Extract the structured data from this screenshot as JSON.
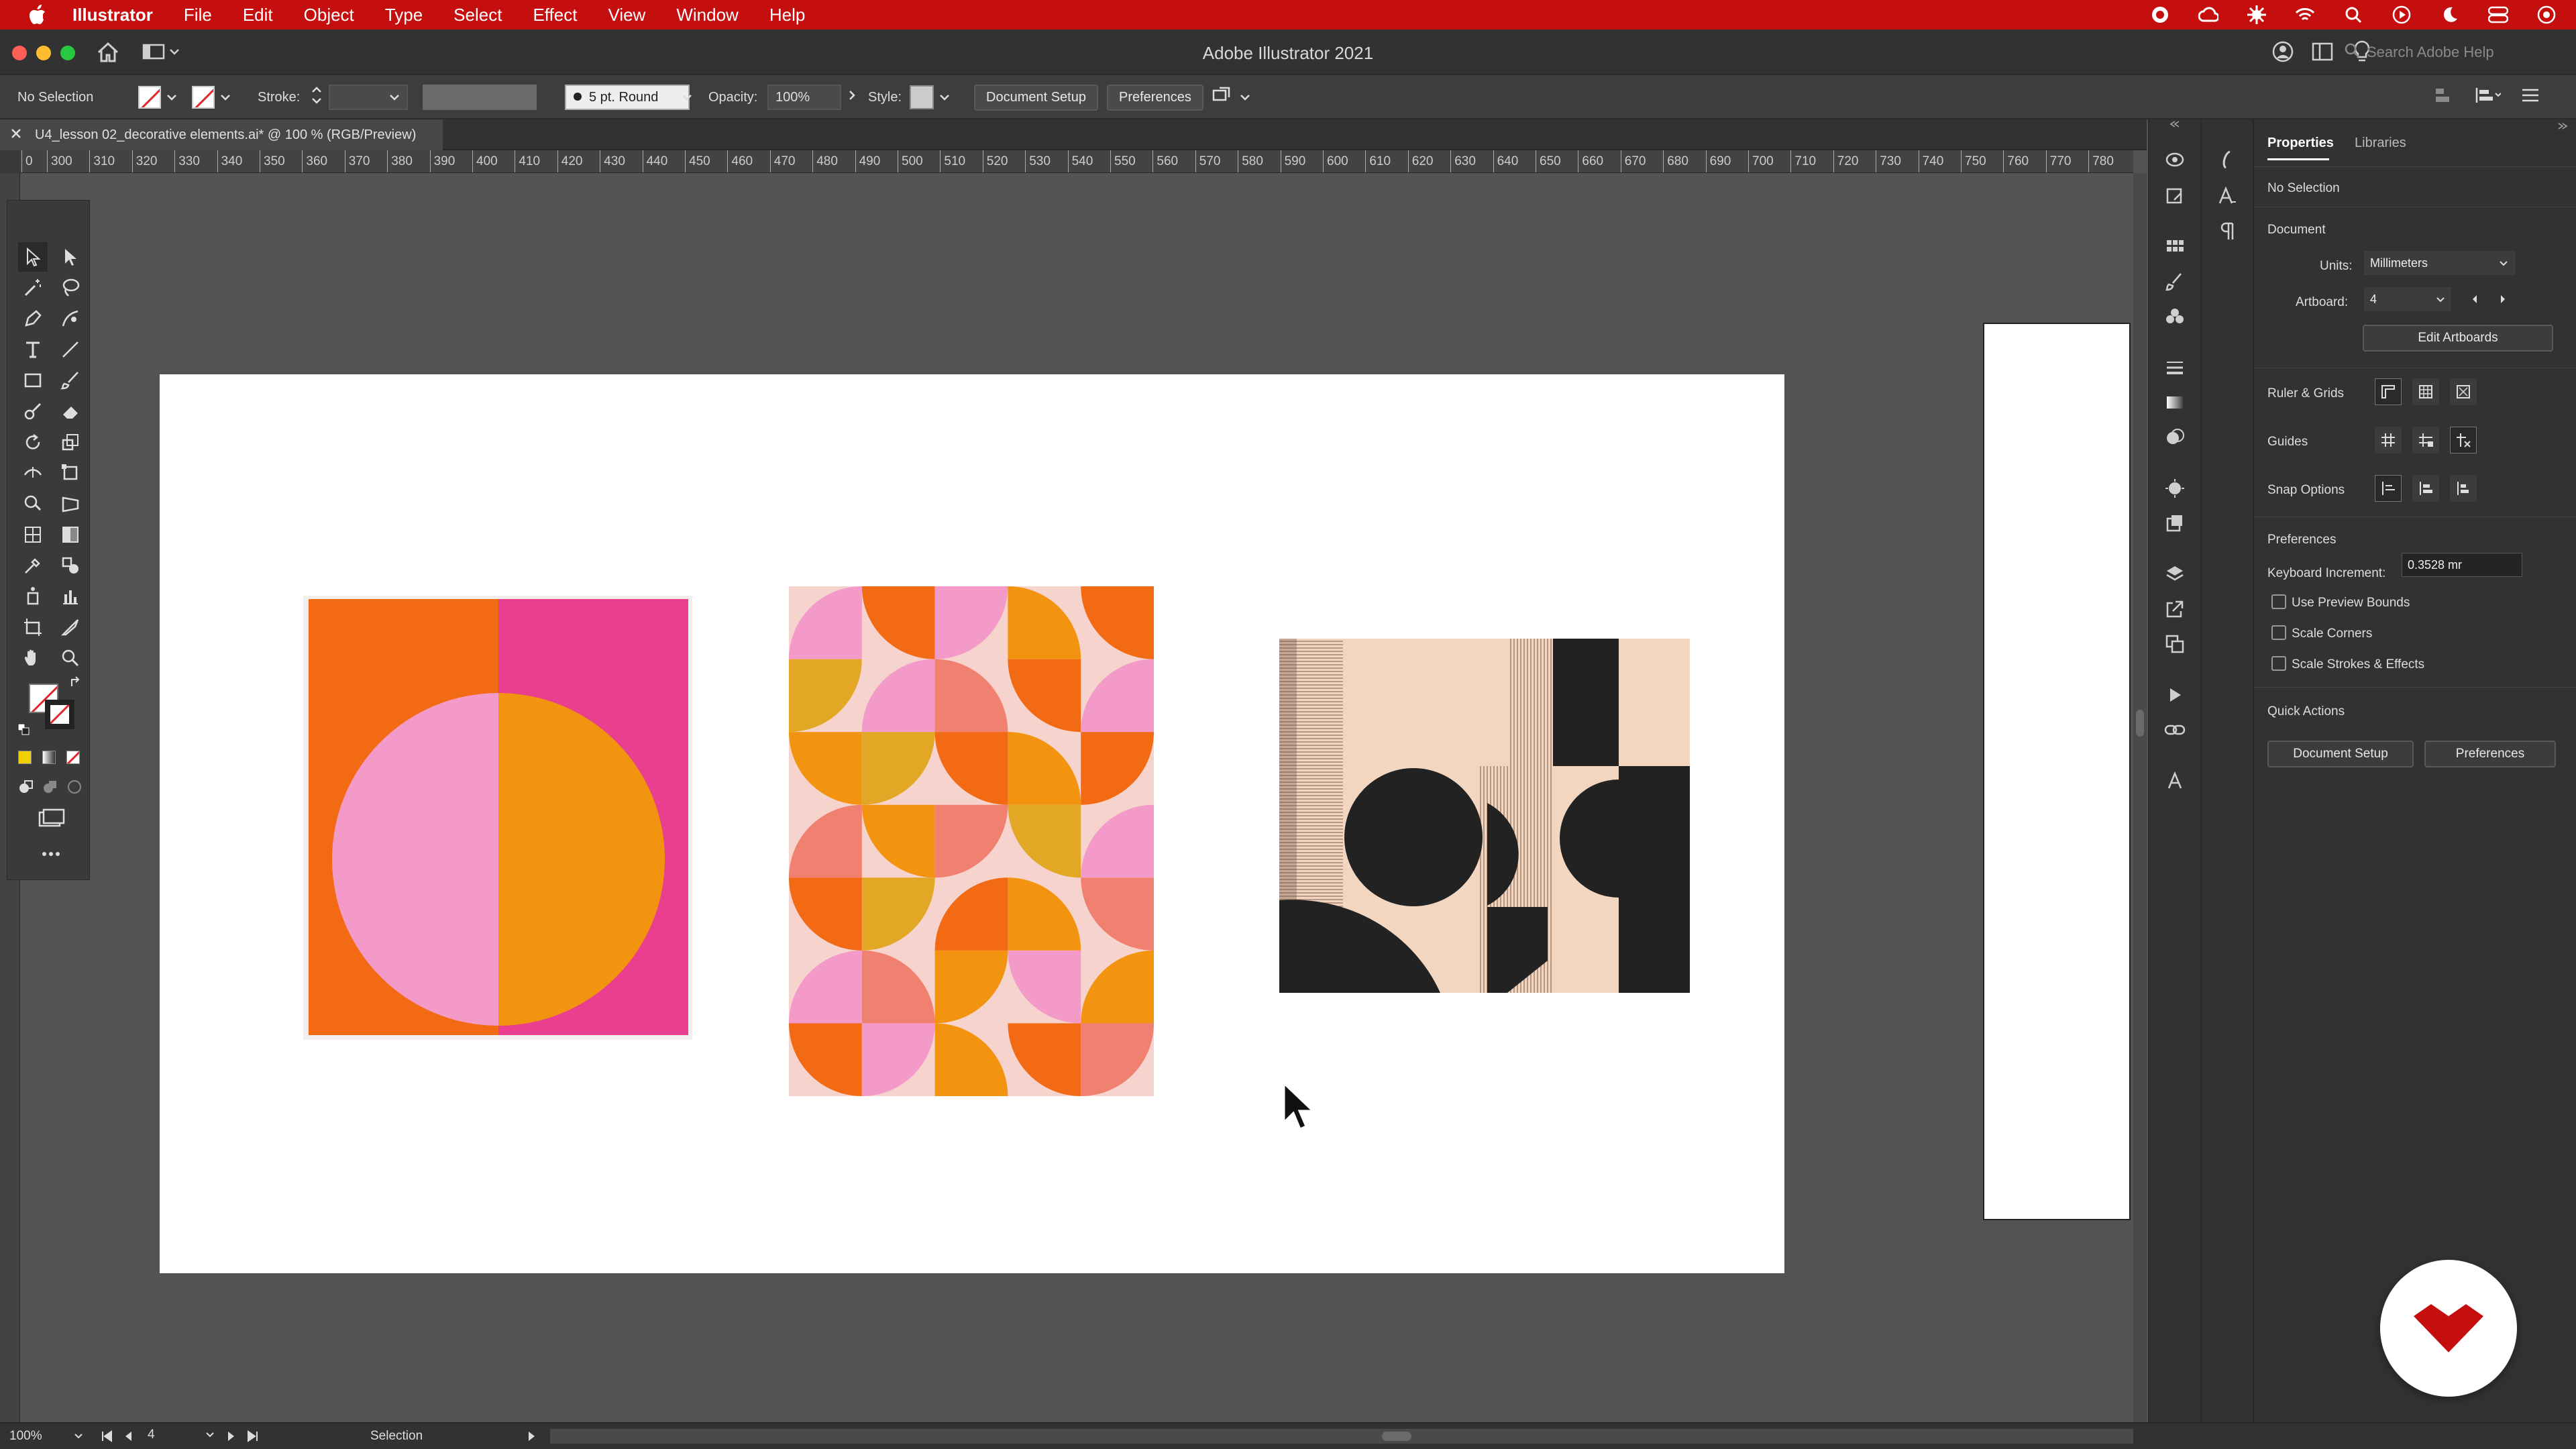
{
  "menubar": {
    "app": "Illustrator",
    "items": [
      "File",
      "Edit",
      "Object",
      "Type",
      "Select",
      "Effect",
      "View",
      "Window",
      "Help"
    ]
  },
  "window": {
    "title": "Adobe Illustrator 2021",
    "search_placeholder": "Search Adobe Help"
  },
  "controlbar": {
    "selection": "No Selection",
    "stroke_label": "Stroke:",
    "brush": "5 pt. Round",
    "opacity_label": "Opacity:",
    "opacity_value": "100%",
    "style_label": "Style:",
    "document_setup": "Document Setup",
    "preferences": "Preferences"
  },
  "document": {
    "tab_title": "U4_lesson 02_decorative elements.ai* @ 100 % (RGB/Preview)"
  },
  "ruler": {
    "h_ticks": [
      "0",
      "300",
      "310",
      "320",
      "330",
      "340",
      "350",
      "360",
      "370",
      "380",
      "390",
      "400",
      "410",
      "420",
      "430",
      "440",
      "450",
      "460",
      "470",
      "480",
      "490",
      "500",
      "510",
      "520",
      "530",
      "540",
      "550",
      "560",
      "570",
      "580",
      "590",
      "600",
      "610",
      "620",
      "630",
      "640",
      "650",
      "660",
      "670",
      "680",
      "690",
      "700",
      "710",
      "720",
      "730",
      "740",
      "750",
      "760",
      "770",
      "780"
    ]
  },
  "properties": {
    "tabs": [
      "Properties",
      "Libraries"
    ],
    "selection": "No Selection",
    "document_heading": "Document",
    "units_label": "Units:",
    "units_value": "Millimeters",
    "artboard_label": "Artboard:",
    "artboard_value": "4",
    "edit_artboards": "Edit Artboards",
    "ruler_grids": "Ruler & Grids",
    "guides": "Guides",
    "snap_options": "Snap Options",
    "preferences_heading": "Preferences",
    "keyboard_increment_label": "Keyboard Increment:",
    "keyboard_increment_value": "0.3528 mr",
    "use_preview_bounds": "Use Preview Bounds",
    "scale_corners": "Scale Corners",
    "scale_strokes": "Scale Strokes & Effects",
    "quick_actions": "Quick Actions",
    "document_setup": "Document Setup",
    "preferences": "Preferences"
  },
  "status": {
    "zoom": "100%",
    "artboard": "4",
    "tool": "Selection"
  },
  "colors": {
    "menubar": "#c50f0f",
    "orange": "#f26a14",
    "pink": "#e93f8e",
    "light_pink": "#f49ac8",
    "amber": "#f39410",
    "mustard": "#e2a825",
    "salmon": "#f08070",
    "beige": "#f3d8c6",
    "dark": "#222222"
  }
}
